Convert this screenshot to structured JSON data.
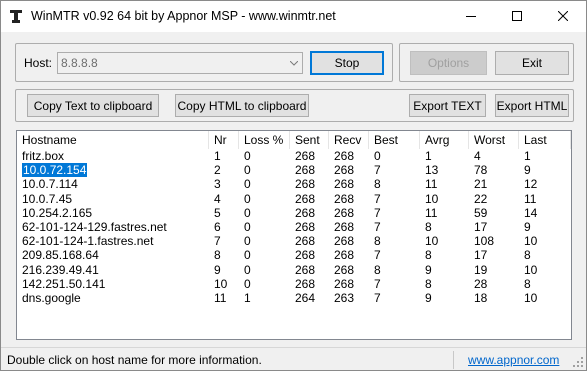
{
  "window": {
    "title": "WinMTR v0.92 64 bit by Appnor MSP - www.winmtr.net",
    "icons": {
      "app": "winmtr-app-icon",
      "minimize": "minimize-icon",
      "maximize": "maximize-icon",
      "close": "close-icon"
    }
  },
  "host": {
    "label": "Host:",
    "value": "8.8.8.8",
    "dropdown_icon": "chevron-down-icon"
  },
  "buttons": {
    "stop": "Stop",
    "options": "Options",
    "exit": "Exit",
    "copy_text": "Copy Text to clipboard",
    "copy_html": "Copy HTML to clipboard",
    "export_text": "Export TEXT",
    "export_html": "Export HTML"
  },
  "table": {
    "columns": [
      "Hostname",
      "Nr",
      "Loss %",
      "Sent",
      "Recv",
      "Best",
      "Avrg",
      "Worst",
      "Last"
    ],
    "rows": [
      [
        "fritz.box",
        "1",
        "0",
        "268",
        "268",
        "0",
        "1",
        "4",
        "1"
      ],
      [
        "10.0.72.154",
        "2",
        "0",
        "268",
        "268",
        "7",
        "13",
        "78",
        "9"
      ],
      [
        "10.0.7.114",
        "3",
        "0",
        "268",
        "268",
        "8",
        "11",
        "21",
        "12"
      ],
      [
        "10.0.7.45",
        "4",
        "0",
        "268",
        "268",
        "7",
        "10",
        "22",
        "11"
      ],
      [
        "10.254.2.165",
        "5",
        "0",
        "268",
        "268",
        "7",
        "11",
        "59",
        "14"
      ],
      [
        "62-101-124-129.fastres.net",
        "6",
        "0",
        "268",
        "268",
        "7",
        "8",
        "17",
        "9"
      ],
      [
        "62-101-124-1.fastres.net",
        "7",
        "0",
        "268",
        "268",
        "8",
        "10",
        "108",
        "10"
      ],
      [
        "209.85.168.64",
        "8",
        "0",
        "268",
        "268",
        "7",
        "8",
        "17",
        "8"
      ],
      [
        "216.239.49.41",
        "9",
        "0",
        "268",
        "268",
        "8",
        "9",
        "19",
        "10"
      ],
      [
        "142.251.50.141",
        "10",
        "0",
        "268",
        "268",
        "7",
        "8",
        "28",
        "8"
      ],
      [
        "dns.google",
        "11",
        "1",
        "264",
        "263",
        "7",
        "9",
        "18",
        "10"
      ]
    ],
    "selected_row": 1
  },
  "status": {
    "message": "Double click on host name for more information.",
    "link": "www.appnor.com",
    "grip_icon": "resize-grip-icon"
  }
}
